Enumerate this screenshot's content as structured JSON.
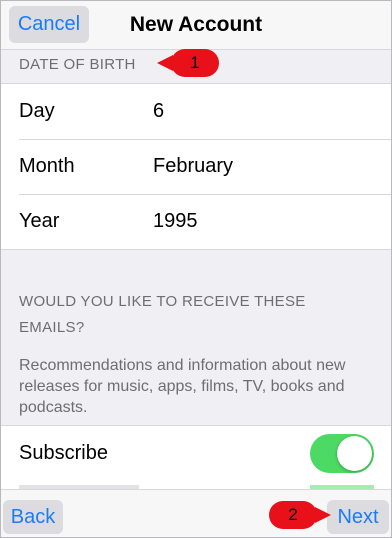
{
  "nav": {
    "cancel_label": "Cancel",
    "title": "New Account"
  },
  "dob": {
    "section_header": "DATE OF BIRTH",
    "rows": [
      {
        "label": "Day",
        "value": "6"
      },
      {
        "label": "Month",
        "value": "February"
      },
      {
        "label": "Year",
        "value": "1995"
      }
    ]
  },
  "emails": {
    "header": "WOULD YOU LIKE TO RECEIVE THESE EMAILS?",
    "description": "Recommendations and information about new releases for music, apps, films, TV, books and podcasts.",
    "subscribe_label": "Subscribe",
    "subscribe_on": true
  },
  "callouts": {
    "first": "1",
    "second": "2"
  },
  "footer": {
    "back_label": "Back",
    "next_label": "Next"
  },
  "colors": {
    "accent": "#1a7cf5",
    "toggle_on": "#4cd964",
    "callout": "#e8111a"
  }
}
